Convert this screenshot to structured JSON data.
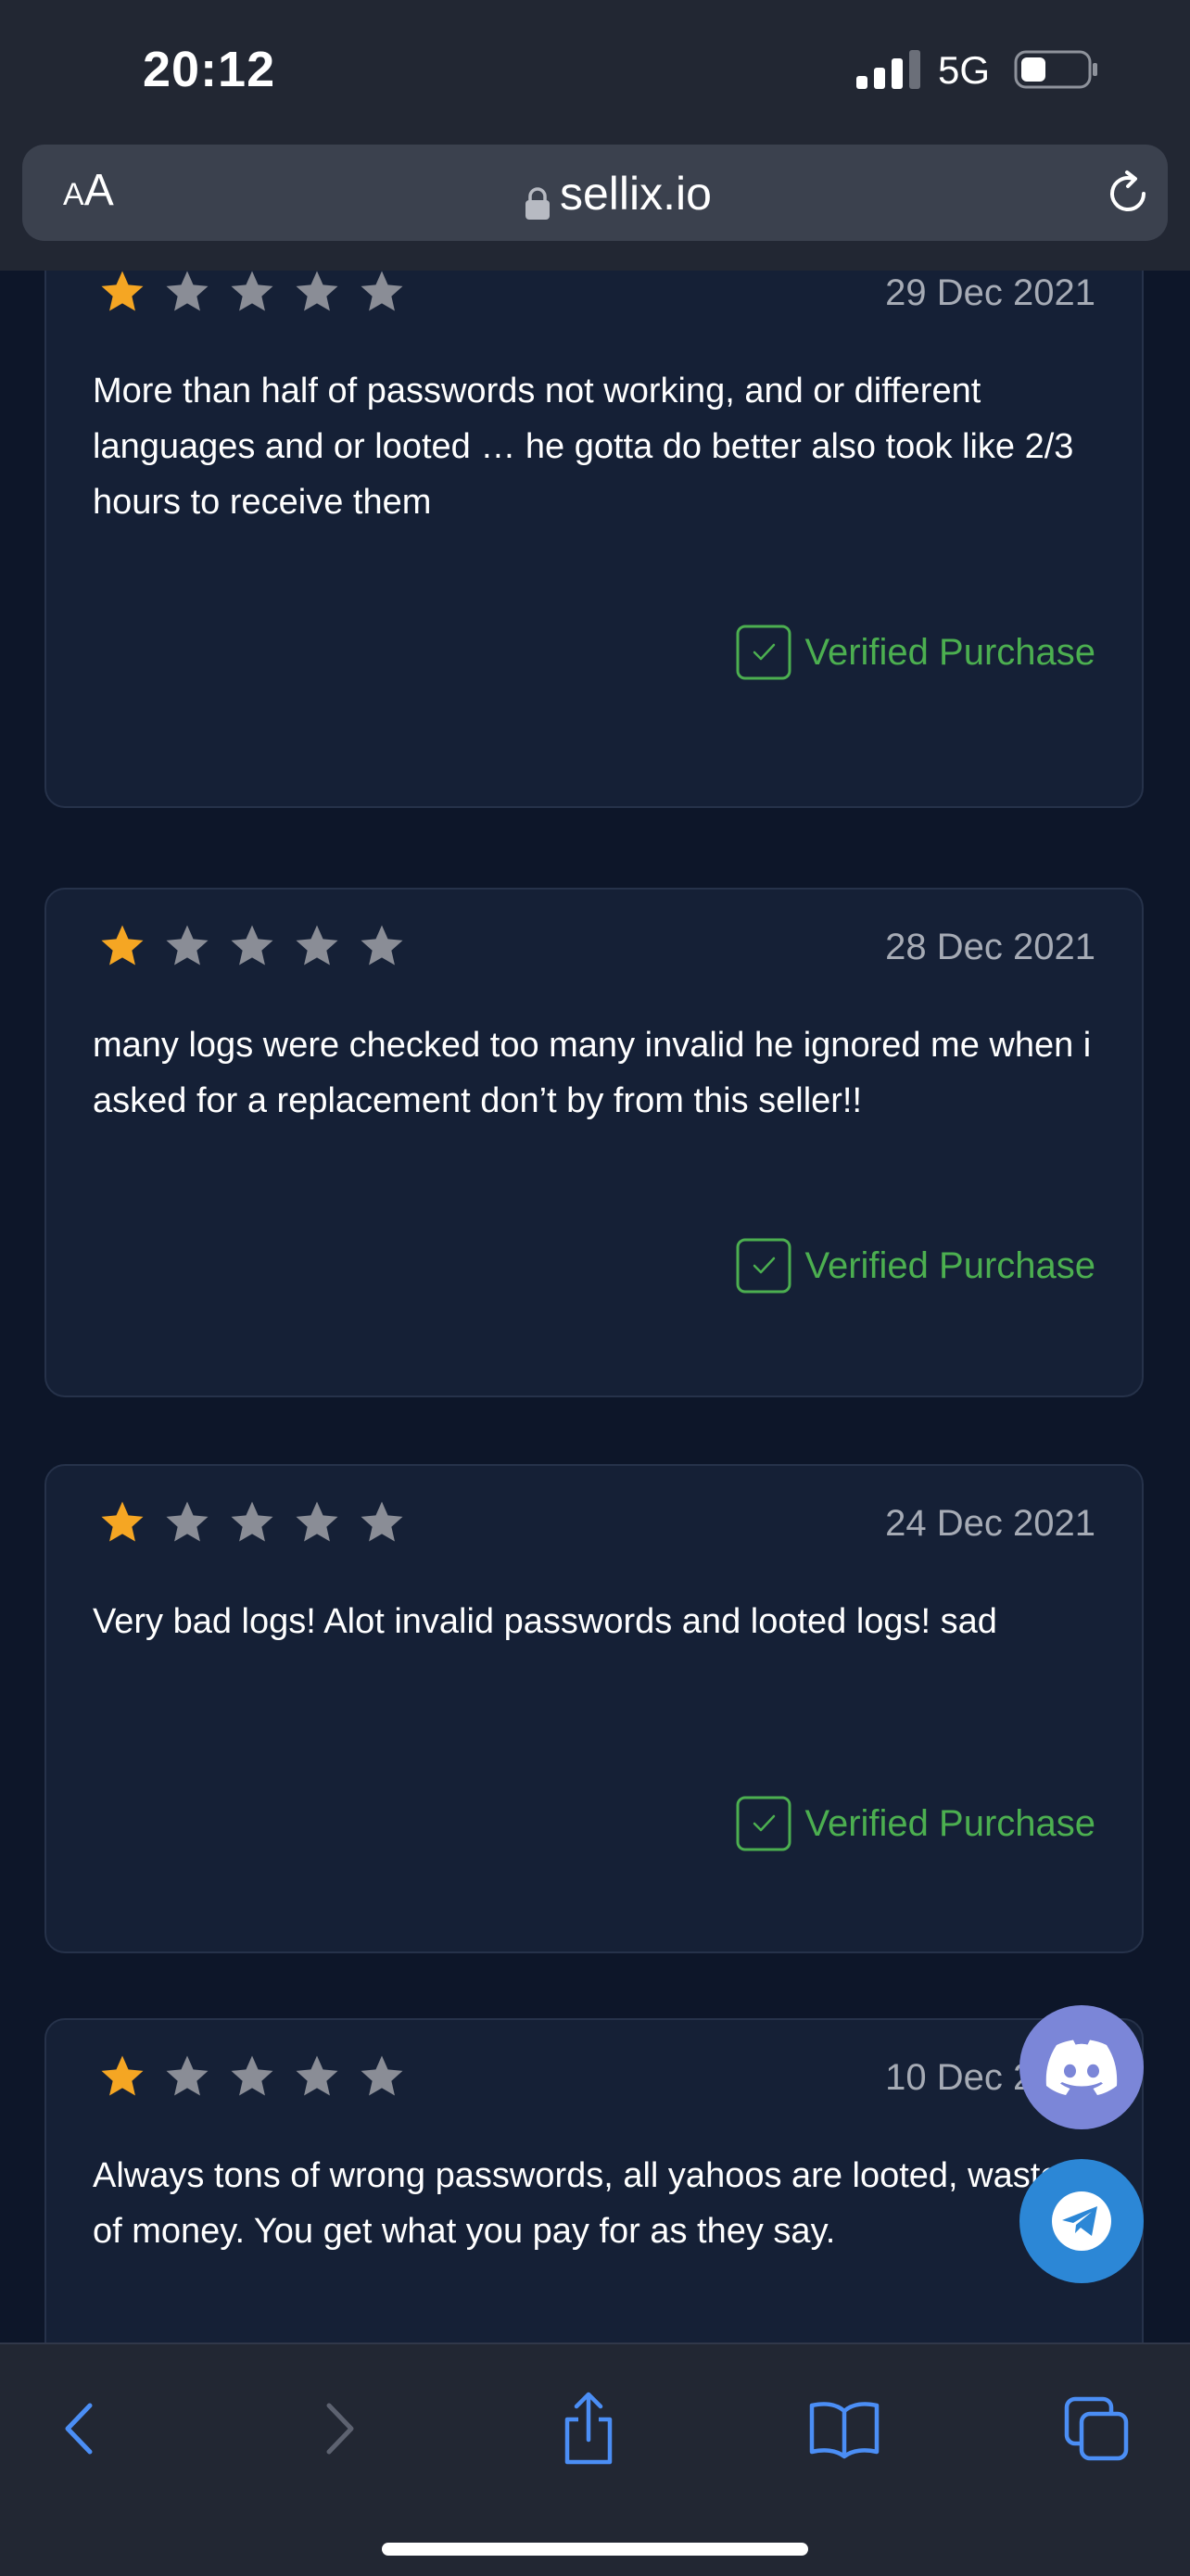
{
  "status_bar": {
    "time": "20:12",
    "network": "5G"
  },
  "browser": {
    "text_size_small": "A",
    "text_size_large": "A",
    "url": "sellix.io"
  },
  "reviews": [
    {
      "rating": 1,
      "max_rating": 5,
      "date": "29 Dec 2021",
      "text": "More than half of passwords not working, and or different languages and or looted … he gotta do better also took like 2/3 hours to receive them",
      "badge": "Verified Purchase"
    },
    {
      "rating": 1,
      "max_rating": 5,
      "date": "28 Dec 2021",
      "text": "many logs were checked too many invalid  he ignored me when i asked for a replacement don’t by from this seller!!",
      "badge": "Verified Purchase"
    },
    {
      "rating": 1,
      "max_rating": 5,
      "date": "24 Dec 2021",
      "text": "Very bad logs! Alot invalid passwords and looted logs! sad",
      "badge": "Verified Purchase"
    },
    {
      "rating": 1,
      "max_rating": 5,
      "date": "10 Dec 2021",
      "text": "Always tons of wrong passwords, all yahoos are looted, waste of money. You get what you pay for as they say."
    }
  ],
  "floating_buttons": [
    "discord-icon",
    "telegram-icon"
  ],
  "toolbar": [
    "back-icon",
    "forward-icon",
    "share-icon",
    "bookmarks-icon",
    "tabs-icon"
  ],
  "colors": {
    "background": "#0d1629",
    "card": "#152036",
    "star_filled": "#f5a623",
    "star_empty": "#8a8d96",
    "verified": "#4caf50",
    "discord": "#7b86d8",
    "telegram": "#2c87d6",
    "toolbar_accent": "#4b8ef5"
  }
}
